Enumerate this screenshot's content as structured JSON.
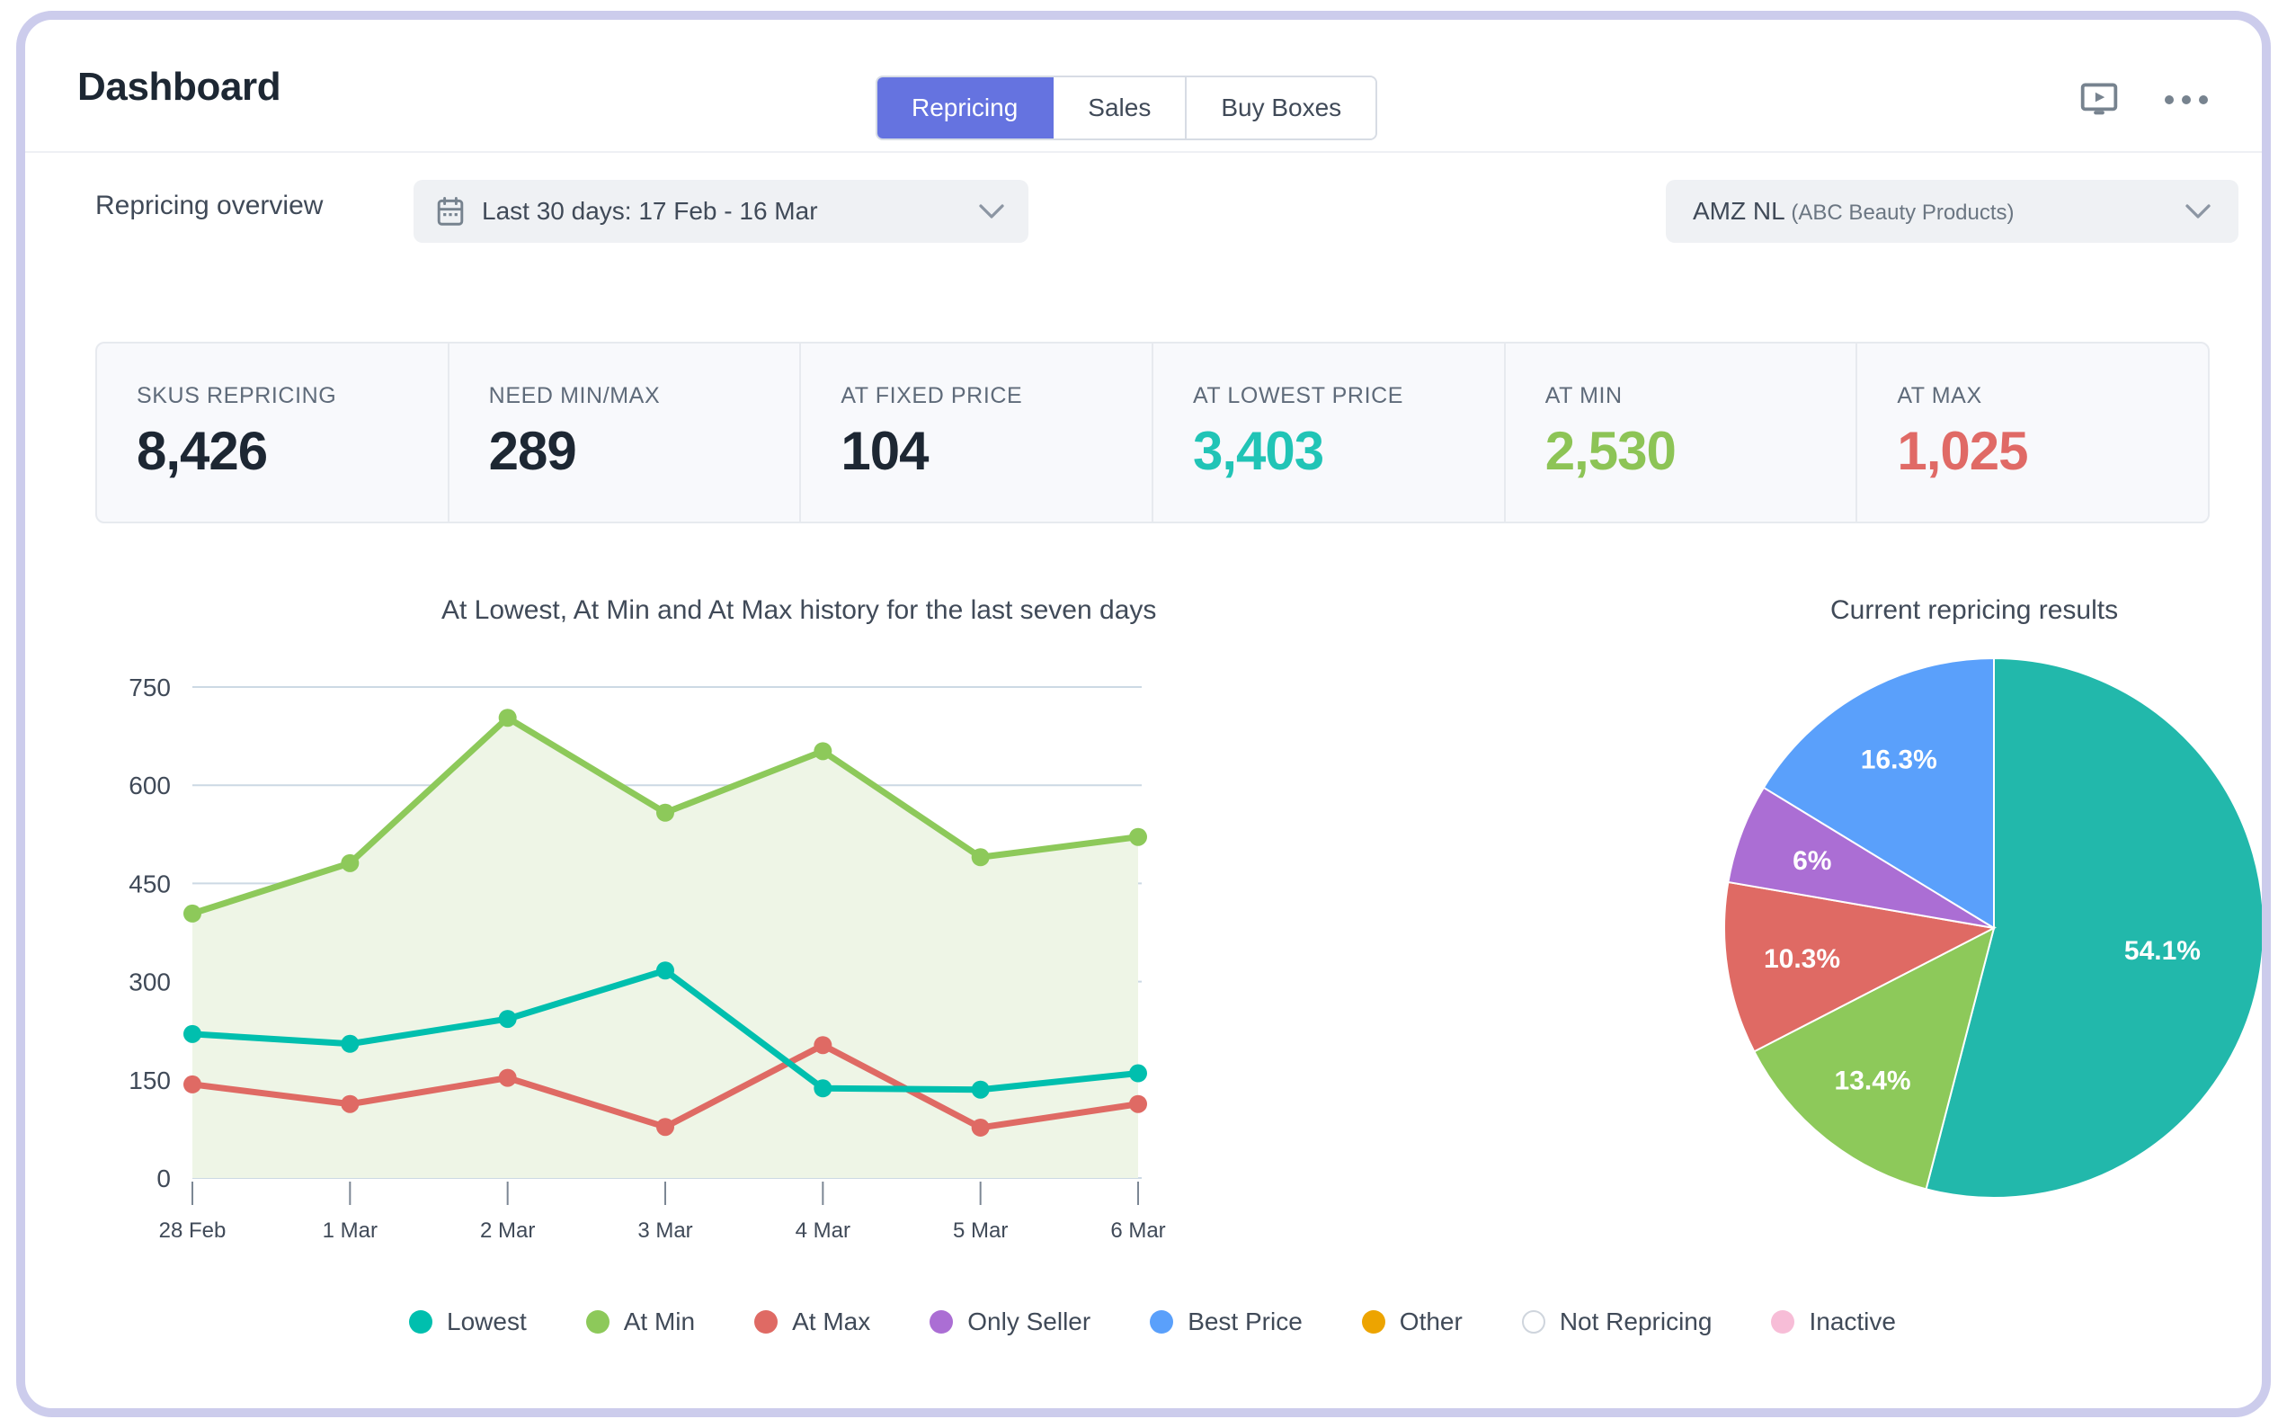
{
  "header": {
    "title": "Dashboard",
    "tabs": [
      {
        "label": "Repricing",
        "active": true
      },
      {
        "label": "Sales",
        "active": false
      },
      {
        "label": "Buy Boxes",
        "active": false
      }
    ],
    "actions": [
      {
        "icon": "screen-play-icon"
      },
      {
        "icon": "more-options-icon"
      }
    ]
  },
  "filters": {
    "section_label": "Repricing overview",
    "date_range": {
      "icon": "calendar-icon",
      "value": "Last 30 days: 17 Feb - 16 Mar",
      "chevron": "chevron-down-icon"
    },
    "account": {
      "flag": "netherlands-flag",
      "name": "AMZ NL ",
      "company": "(ABC Beauty Products)",
      "chevron": "chevron-down-icon"
    }
  },
  "kpis": [
    {
      "label": "SKUS REPRICING",
      "value": "8,426",
      "color": "#1d2733"
    },
    {
      "label": "NEED MIN/MAX",
      "value": "289",
      "color": "#1d2733"
    },
    {
      "label": "AT FIXED PRICE",
      "value": "104",
      "color": "#1d2733"
    },
    {
      "label": "AT LOWEST PRICE",
      "value": "3,403",
      "color": "#21c4b6"
    },
    {
      "label": "AT MIN",
      "value": "2,530",
      "color": "#8dc456"
    },
    {
      "label": "AT MAX",
      "value": "1,025",
      "color": "#e06a66"
    }
  ],
  "legend": [
    {
      "label": "Lowest",
      "color": "#00bfae",
      "hollow": false
    },
    {
      "label": "At Min",
      "color": "#8dc95a",
      "hollow": false
    },
    {
      "label": "At Max",
      "color": "#df6a64",
      "hollow": false
    },
    {
      "label": "Only Seller",
      "color": "#a濃",
      "hollow": false
    },
    {
      "label": "Best Price",
      "color": "#5aa0fb",
      "hollow": false
    },
    {
      "label": "Other",
      "color": "#eda400",
      "hollow": false
    },
    {
      "label": "Not Repricing",
      "color": "#ffffff",
      "hollow": true
    },
    {
      "label": "Inactive",
      "color": "#f7bdd7",
      "hollow": false
    }
  ],
  "chart_data": [
    {
      "type": "line",
      "title": "At Lowest, At Min and At Max history for the last seven days",
      "xlabel": "",
      "ylabel": "",
      "ylim": [
        0,
        750
      ],
      "yticks": [
        0,
        150,
        300,
        450,
        600,
        750
      ],
      "grid": true,
      "legend_position": "bottom",
      "x": [
        "28 Feb",
        "1 Mar",
        "2 Mar",
        "3 Mar",
        "4 Mar",
        "5 Mar",
        "6 Mar"
      ],
      "series": [
        {
          "name": "Lowest",
          "color": "#00bfae",
          "values": [
            220,
            205,
            243,
            317,
            137,
            135,
            160
          ]
        },
        {
          "name": "At Min",
          "color": "#8dc95a",
          "values": [
            404,
            481,
            703,
            558,
            652,
            490,
            521
          ],
          "area": true
        },
        {
          "name": "At Max",
          "color": "#df6a64",
          "values": [
            143,
            113,
            153,
            78,
            203,
            77,
            113
          ]
        }
      ]
    },
    {
      "type": "pie",
      "title": "Current repricing results",
      "legend_position": "bottom",
      "labels": [
        "Lowest",
        "At Min",
        "At Max",
        "Only Seller",
        "Best Price"
      ],
      "values": [
        54.1,
        13.4,
        10.3,
        6.0,
        16.3
      ],
      "display_labels": [
        "54.1%",
        "13.4%",
        "10.3%",
        "6%",
        "16.3%"
      ],
      "colors": [
        "#22b8ab",
        "#8dc95a",
        "#df6a64",
        "#ab6ed4",
        "#5aa0fb"
      ]
    }
  ]
}
